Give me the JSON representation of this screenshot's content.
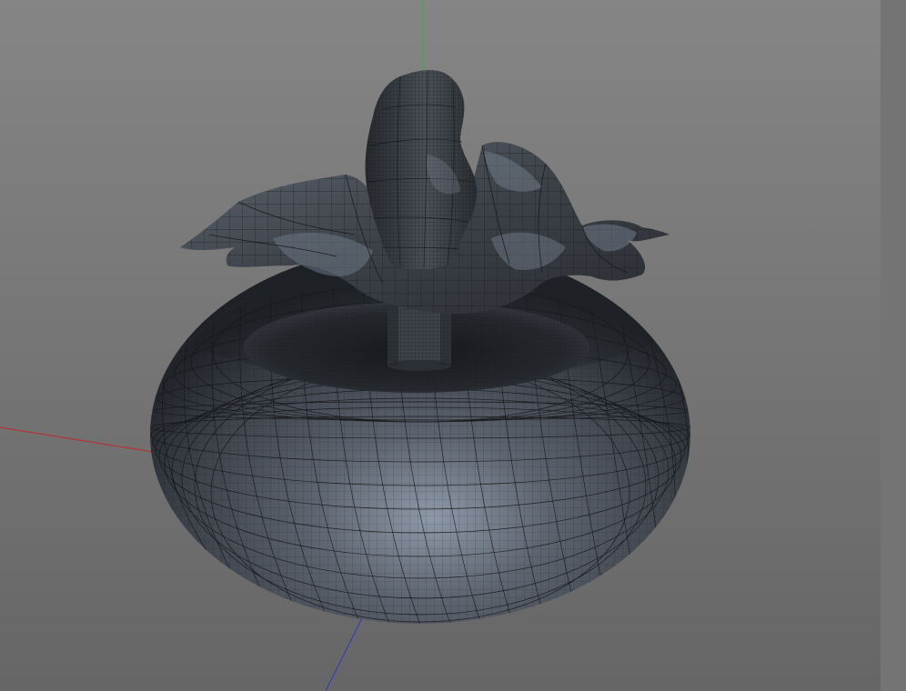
{
  "viewport": {
    "background_top": "#838383",
    "background_bottom": "#636363",
    "axis_x_color": "#c0282a",
    "axis_y_color": "#2eb82e",
    "axis_z_color": "#2f36c8",
    "mesh_color": "#3a3e44",
    "mesh_highlight": "#8a96a6",
    "wire_color": "#141517"
  },
  "side_panel": {
    "color": "#747474"
  }
}
